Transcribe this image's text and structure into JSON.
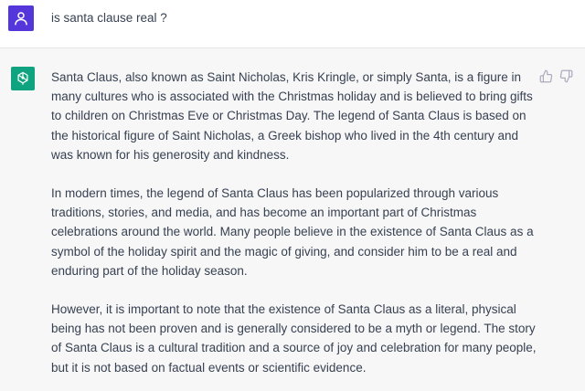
{
  "user_message": {
    "avatar_icon": "user-icon",
    "text": "is santa clause real ?"
  },
  "assistant_message": {
    "avatar_icon": "openai-logo-icon",
    "paragraphs": [
      "Santa Claus, also known as Saint Nicholas, Kris Kringle, or simply Santa, is a figure in many cultures who is associated with the Christmas holiday and is believed to bring gifts to children on Christmas Eve or Christmas Day. The legend of Santa Claus is based on the historical figure of Saint Nicholas, a Greek bishop who lived in the 4th century and was known for his generosity and kindness.",
      "In modern times, the legend of Santa Claus has been popularized through various traditions, stories, and media, and has become an important part of Christmas celebrations around the world. Many people believe in the existence of Santa Claus as a symbol of the holiday spirit and the magic of giving, and consider him to be a real and enduring part of the holiday season.",
      "However, it is important to note that the existence of Santa Claus as a literal, physical being has not been proven and is generally considered to be a myth or legend. The story of Santa Claus is a cultural tradition and a source of joy and celebration for many people, but it is not based on factual events or scientific evidence."
    ],
    "feedback": {
      "thumbs_up_icon": "thumbs-up-icon",
      "thumbs_down_icon": "thumbs-down-icon"
    }
  },
  "colors": {
    "user_avatar_bg": "#5436da",
    "assistant_avatar_bg": "#10a37f",
    "assistant_row_bg": "#f7f7f8",
    "text": "#374151",
    "icon": "#acacbe"
  }
}
